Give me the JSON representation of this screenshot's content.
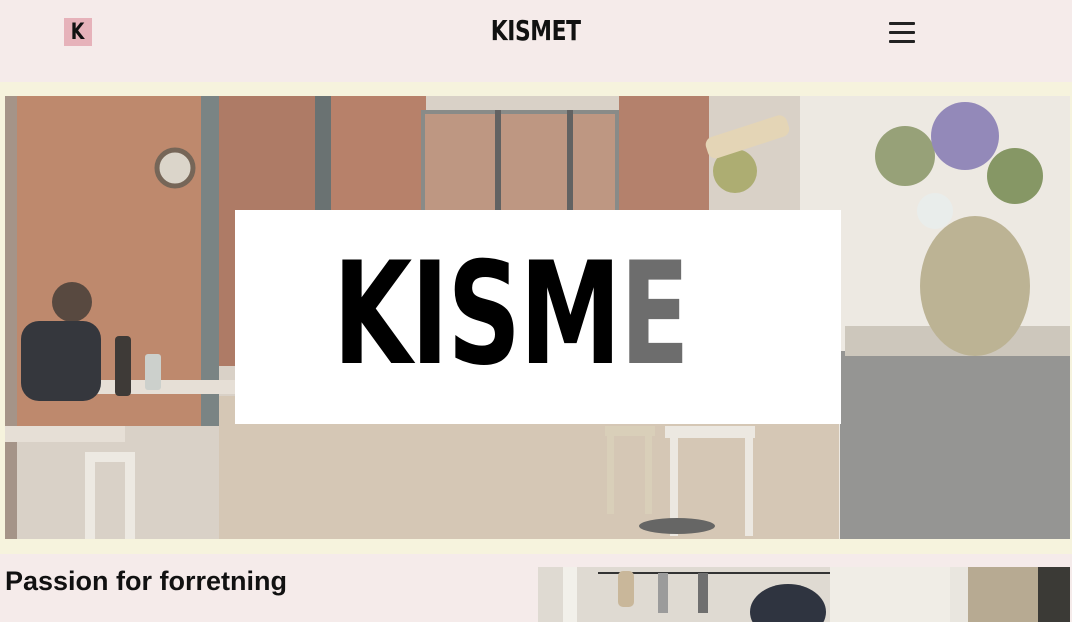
{
  "header": {
    "logo_letter": "K",
    "brand": "KISMET",
    "menu_icon": "hamburger-menu-icon"
  },
  "hero": {
    "word_dark": "KISM",
    "word_light": "E",
    "image": "restaurant-interior-photo"
  },
  "section": {
    "title": "Passion for forretning",
    "image": "kitchen-staff-photo"
  },
  "colors": {
    "page_background": "#f5ebea",
    "band_background": "#f6f3dd",
    "logo_badge": "#e6b2ba",
    "text": "#111111",
    "hero_letter_light": "#6d6d6d"
  }
}
